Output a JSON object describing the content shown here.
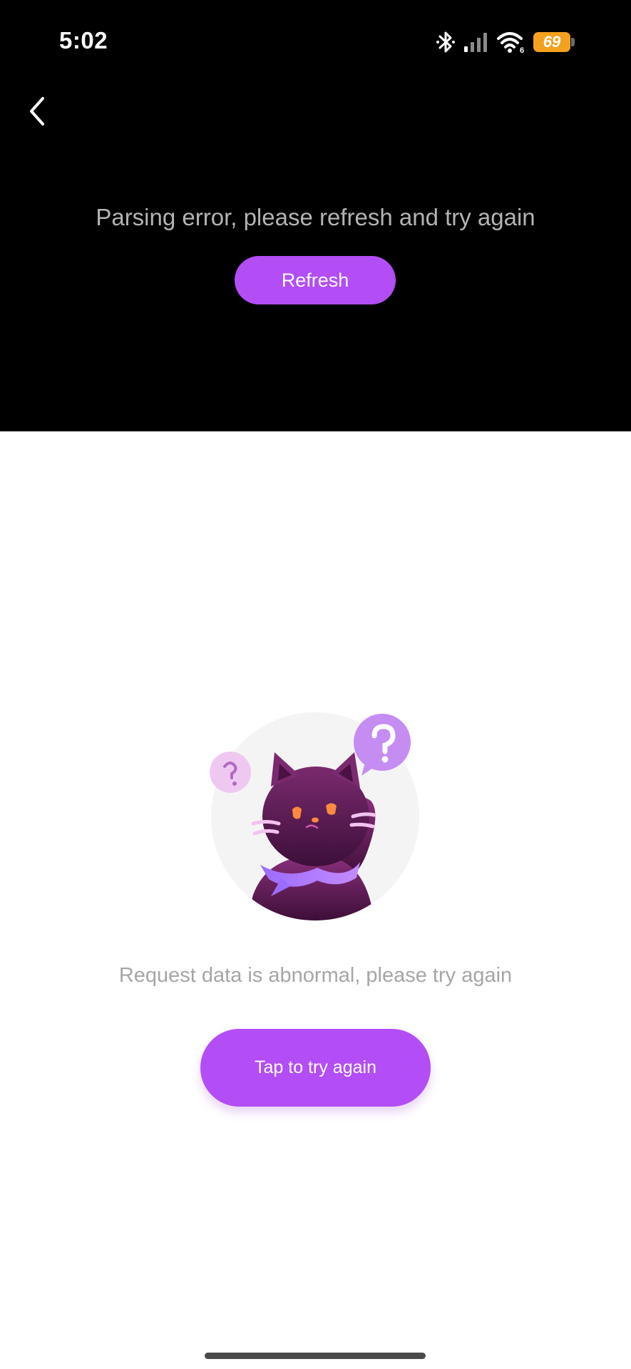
{
  "status_bar": {
    "time": "5:02",
    "battery_level": "69",
    "icons": [
      "bluetooth-icon",
      "cellular-signal-icon",
      "wifi-6-icon",
      "battery-icon"
    ]
  },
  "header": {
    "back_icon": "chevron-left-icon"
  },
  "player_error": {
    "message": "Parsing error, please refresh and try again",
    "refresh_label": "Refresh"
  },
  "content_error": {
    "illustration": "confused-cat-illustration",
    "message": "Request data is abnormal, please try again",
    "retry_label": "Tap to try again"
  },
  "colors": {
    "accent": "#b34df5",
    "top_background": "#000000",
    "page_background": "#ffffff",
    "battery": "#f3a11e"
  }
}
